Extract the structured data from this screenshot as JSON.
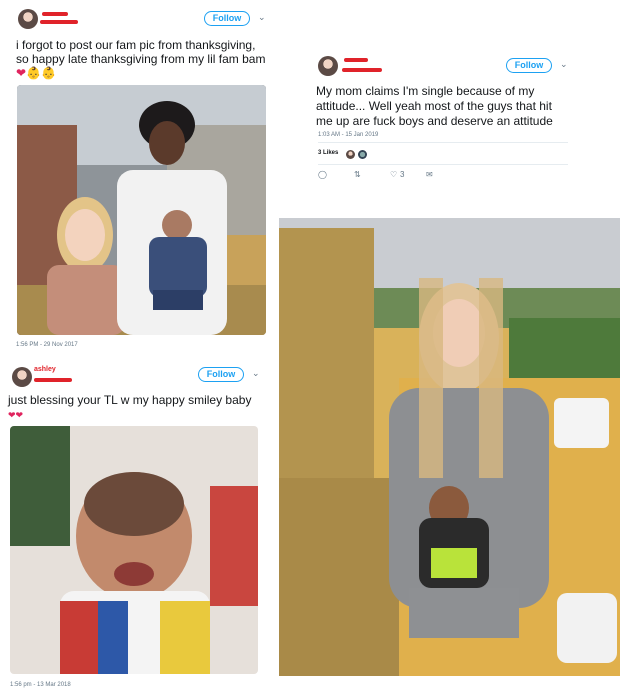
{
  "tweet1": {
    "follow_label": "Follow",
    "text": "i forgot to post our fam pic from thanksgiving, so happy late thanksgiving from my lil fam bam",
    "timestamp": "1:56 PM - 29 Nov 2017"
  },
  "tweet2": {
    "follow_label": "Follow",
    "text": "My mom claims I'm single because of my attitude... Well yeah most of the guys that hit me up are fuck boys and deserve an attitude",
    "timestamp": "1:03 AM - 15 Jan 2019",
    "likes_label": "3 Likes",
    "reply_count": "",
    "like_count": "3"
  },
  "tweet3": {
    "follow_label": "Follow",
    "username": "ashley",
    "text": "just blessing your TL w my happy smiley baby",
    "timestamp": "1:56 pm - 13 Mar 2018"
  },
  "colors": {
    "accent": "#1da1f2",
    "redaction": "#e0232a",
    "heart": "#e0245e"
  }
}
